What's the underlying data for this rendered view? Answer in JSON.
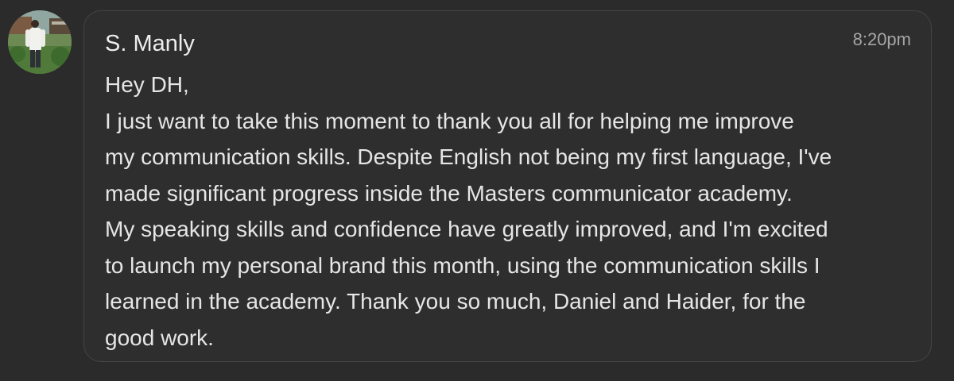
{
  "message": {
    "sender": "S. Manly",
    "time": "8:20pm",
    "lines": [
      "Hey DH,",
      "I just want to take this moment to thank you all for helping me improve",
      "my communication skills. Despite English not being my first language, I've",
      "made significant progress inside the Masters communicator academy.",
      "My speaking skills and confidence have greatly improved, and I'm excited",
      "to launch my personal brand this month, using the communication skills I",
      "learned in the academy. Thank you so much, Daniel and Haider, for the",
      "good work."
    ]
  },
  "colors": {
    "background": "#2b2b2b",
    "bubble": "#2e2e2e",
    "bubble_border": "#444444",
    "text": "#e6e6e6",
    "time": "#a6a6a6"
  },
  "avatar": {
    "icon": "user-photo-avatar"
  }
}
